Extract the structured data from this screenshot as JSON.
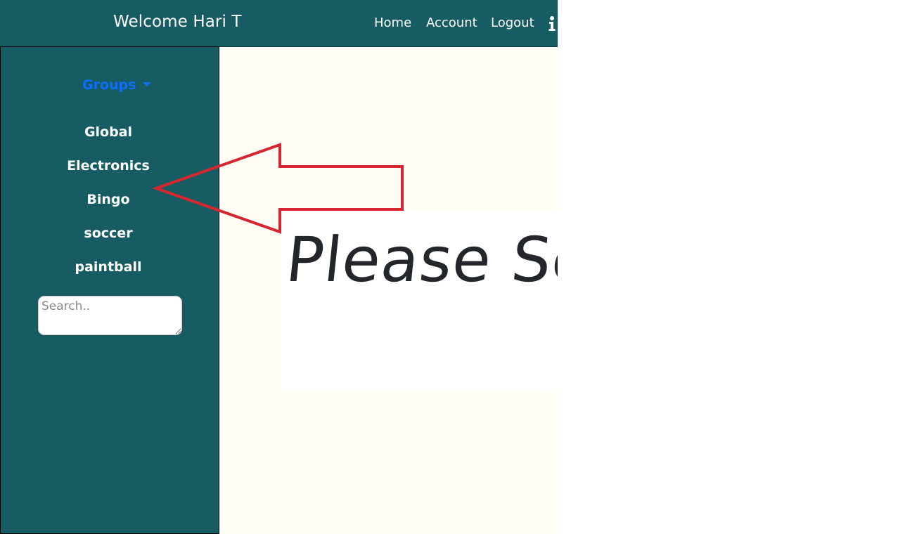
{
  "theme": {
    "teal": "#175c62",
    "link": "#0d6efd",
    "arrow": "#d7262f",
    "content_bg": "#fffdf6"
  },
  "header": {
    "welcome": "Welcome Hari T",
    "nav": {
      "home": "Home",
      "account": "Account",
      "logout": "Logout"
    },
    "info_icon": "info-icon"
  },
  "sidebar": {
    "groups_label": "Groups",
    "groups": [
      {
        "label": "Global"
      },
      {
        "label": "Electronics"
      },
      {
        "label": "Bingo"
      },
      {
        "label": "soccer"
      },
      {
        "label": "paintball"
      }
    ],
    "search": {
      "placeholder": "Search..",
      "value": ""
    }
  },
  "main": {
    "hero_text": "Please Se"
  }
}
